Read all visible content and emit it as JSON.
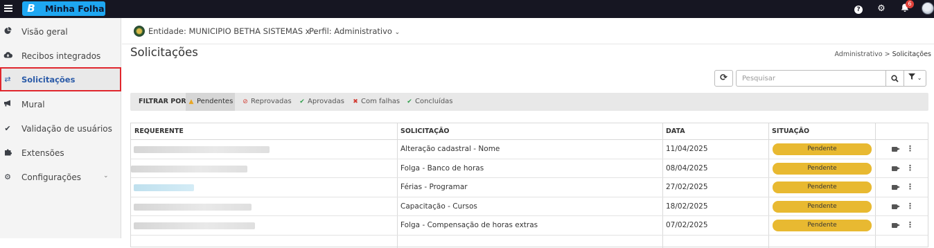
{
  "topbar": {
    "logo_letter": "B",
    "app_name": "Minha Folha",
    "notification_count": "6"
  },
  "sidebar": {
    "items": [
      {
        "label": "Visão geral",
        "icon": "pie-chart-icon"
      },
      {
        "label": "Recibos integrados",
        "icon": "cloud-download-icon"
      },
      {
        "label": "Solicitações",
        "icon": "exchange-arrows-icon",
        "active": true
      },
      {
        "label": "Mural",
        "icon": "megaphone-icon"
      },
      {
        "label": "Validação de usuários",
        "icon": "check-icon"
      },
      {
        "label": "Extensões",
        "icon": "puzzle-icon"
      },
      {
        "label": "Configurações",
        "icon": "cogs-icon",
        "expandable": true
      }
    ]
  },
  "context": {
    "entity_label": "Entidade: MUNICIPIO BETHA SISTEMAS x",
    "profile_label": "Perfil: Administrativo"
  },
  "page": {
    "title": "Solicitações",
    "breadcrumb_parent": "Administrativo",
    "breadcrumb_separator": ">",
    "breadcrumb_current": "Solicitações"
  },
  "toolbar": {
    "search_placeholder": "Pesquisar"
  },
  "filters": {
    "label": "FILTRAR POR",
    "options": [
      {
        "label": "Pendentes",
        "icon": "warning-icon",
        "color": "#e8a623",
        "active": true
      },
      {
        "label": "Reprovadas",
        "icon": "ban-icon",
        "color": "#d23b32"
      },
      {
        "label": "Aprovadas",
        "icon": "check-icon",
        "color": "#2f9e4c"
      },
      {
        "label": "Com falhas",
        "icon": "times-circle-icon",
        "color": "#d23b32"
      },
      {
        "label": "Concluídas",
        "icon": "check-circle-icon",
        "color": "#2f9e4c"
      }
    ]
  },
  "table": {
    "columns": [
      "REQUERENTE",
      "SOLICITAÇÃO",
      "DATA",
      "SITUAÇÃO"
    ],
    "rows": [
      {
        "solicitacao": "Alteração cadastral - Nome",
        "data": "11/04/2025",
        "situacao": "Pendente"
      },
      {
        "solicitacao": "Folga - Banco de horas",
        "data": "08/04/2025",
        "situacao": "Pendente"
      },
      {
        "solicitacao": "Férias - Programar",
        "data": "27/02/2025",
        "situacao": "Pendente"
      },
      {
        "solicitacao": "Capacitação - Cursos",
        "data": "18/02/2025",
        "situacao": "Pendente"
      },
      {
        "solicitacao": "Folga - Compensação de horas extras",
        "data": "07/02/2025",
        "situacao": "Pendente"
      }
    ]
  },
  "colors": {
    "topbar": "#161622",
    "brand": "#1ea7f2",
    "status_pending": "#e8b931",
    "active_link": "#2b5ba8",
    "highlight_border": "#e0262d"
  }
}
